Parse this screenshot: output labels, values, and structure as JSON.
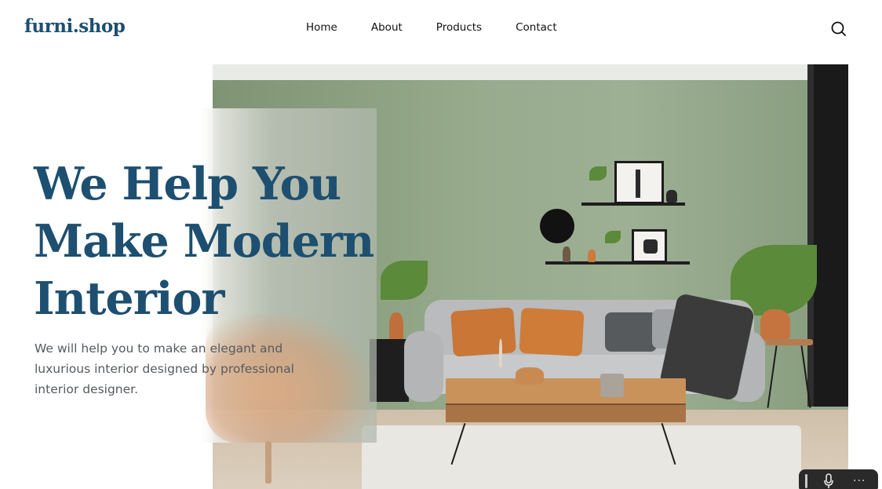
{
  "header": {
    "logo": "furni.shop",
    "nav": [
      {
        "label": "Home"
      },
      {
        "label": "About"
      },
      {
        "label": "Products"
      },
      {
        "label": "Contact"
      }
    ],
    "search_icon": "search-icon"
  },
  "hero": {
    "title_lines": [
      "We Help You",
      "Make Modern",
      "Interior"
    ],
    "description_lines": [
      "We will help you to make an elegant and",
      "luxurious interior designed by professional",
      "interior designer."
    ],
    "image": "living-room-interior-photo"
  },
  "floating_toolbar": {
    "icons": [
      "grip-icon",
      "microphone-icon",
      "more-icon"
    ],
    "more_label": "···"
  },
  "colors": {
    "brand": "#1d4f70",
    "text": "#111111",
    "muted_text": "#555b5e",
    "wall": "#98ab8d"
  }
}
